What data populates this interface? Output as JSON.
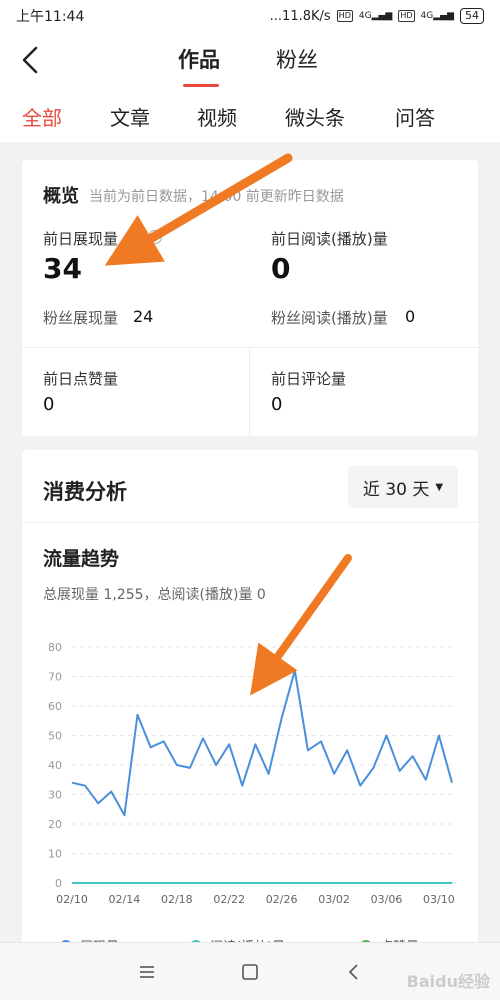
{
  "status_bar": {
    "time": "上午11:44",
    "speed": "...11.8K/s",
    "hd": "HD",
    "net": "4G",
    "battery": "54"
  },
  "header": {
    "tabs": [
      {
        "label": "作品",
        "active": true
      },
      {
        "label": "粉丝",
        "active": false
      }
    ]
  },
  "sub_tabs": [
    {
      "label": "全部",
      "active": true
    },
    {
      "label": "文章",
      "active": false
    },
    {
      "label": "视频",
      "active": false
    },
    {
      "label": "微头条",
      "active": false
    },
    {
      "label": "问答",
      "active": false
    }
  ],
  "overview": {
    "title": "概览",
    "subtitle": "当前为前日数据，14:00 前更新昨日数据",
    "metrics": {
      "impressions": {
        "label": "前日展现量",
        "value": "34",
        "fan_label": "粉丝展现量",
        "fan_value": "24"
      },
      "reads": {
        "label": "前日阅读(播放)量",
        "value": "0",
        "fan_label": "粉丝阅读(播放)量",
        "fan_value": "0"
      },
      "likes": {
        "label": "前日点赞量",
        "value": "0"
      },
      "comments": {
        "label": "前日评论量",
        "value": "0"
      }
    }
  },
  "consumption": {
    "title": "消费分析",
    "range": "近 30 天",
    "trend_title": "流量趋势",
    "summary": "总展现量 1,255，总阅读(播放)量 0"
  },
  "chart_data": {
    "type": "line",
    "title": "流量趋势",
    "xlabel": "",
    "ylabel": "",
    "ylim": [
      0,
      80
    ],
    "yticks": [
      0,
      10,
      20,
      30,
      40,
      50,
      60,
      70,
      80
    ],
    "x": [
      "02/10",
      "02/11",
      "02/12",
      "02/13",
      "02/14",
      "02/15",
      "02/16",
      "02/17",
      "02/18",
      "02/19",
      "02/20",
      "02/21",
      "02/22",
      "02/23",
      "02/24",
      "02/25",
      "02/26",
      "02/27",
      "02/28",
      "03/01",
      "03/02",
      "03/03",
      "03/04",
      "03/05",
      "03/06",
      "03/07",
      "03/08",
      "03/09",
      "03/10",
      "03/11"
    ],
    "xtick_labels": [
      "02/10",
      "02/14",
      "02/18",
      "02/22",
      "02/26",
      "03/02",
      "03/06",
      "03/10"
    ],
    "grid": true,
    "series": [
      {
        "name": "展现量",
        "color": "#4a8fdc",
        "values": [
          34,
          33,
          27,
          31,
          23,
          57,
          46,
          48,
          40,
          39,
          49,
          40,
          47,
          33,
          47,
          37,
          56,
          72,
          45,
          48,
          37,
          45,
          33,
          39,
          50,
          38,
          43,
          35,
          50,
          34
        ]
      },
      {
        "name": "阅读(播放)量",
        "color": "#3ec6c1",
        "values": [
          0,
          0,
          0,
          0,
          0,
          0,
          0,
          0,
          0,
          0,
          0,
          0,
          0,
          0,
          0,
          0,
          0,
          0,
          0,
          0,
          0,
          0,
          0,
          0,
          0,
          0,
          0,
          0,
          0,
          0
        ]
      }
    ],
    "legend": [
      "展现量",
      "阅读(播放)量",
      "点赞量"
    ],
    "legend_colors": [
      "#4a8fdc",
      "#3ec6c1",
      "#4caf50"
    ]
  },
  "watermark": "Baidu经验"
}
